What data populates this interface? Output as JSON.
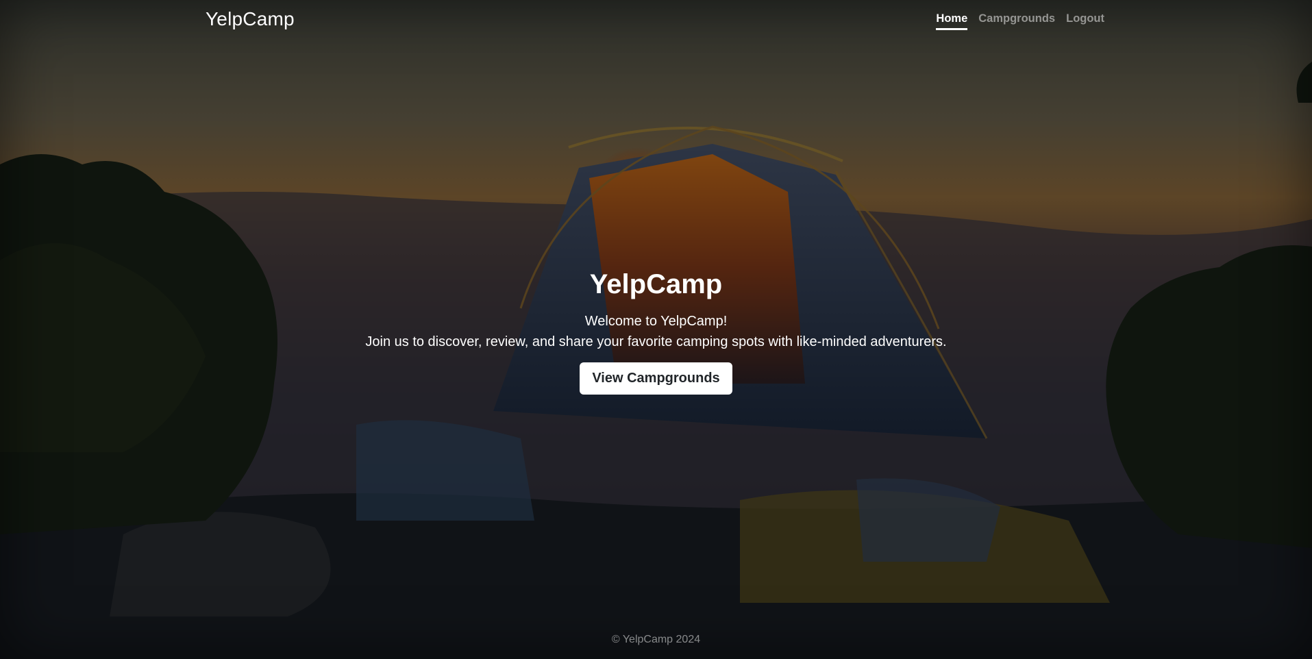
{
  "navbar": {
    "brand": "YelpCamp",
    "links": [
      {
        "label": "Home",
        "active": true
      },
      {
        "label": "Campgrounds",
        "active": false
      },
      {
        "label": "Logout",
        "active": false
      }
    ]
  },
  "hero": {
    "title": "YelpCamp",
    "lead_line1": "Welcome to YelpCamp!",
    "lead_line2": "Join us to discover, review, and share your favorite camping spots with like-minded adventurers.",
    "button_label": "View Campgrounds",
    "background_icon": "tent-at-sunset-photo"
  },
  "footer": {
    "text": "© YelpCamp 2024"
  },
  "colors": {
    "overlay": "#000000",
    "text": "#ffffff",
    "button_bg": "#ffffff",
    "button_text": "#212529"
  }
}
